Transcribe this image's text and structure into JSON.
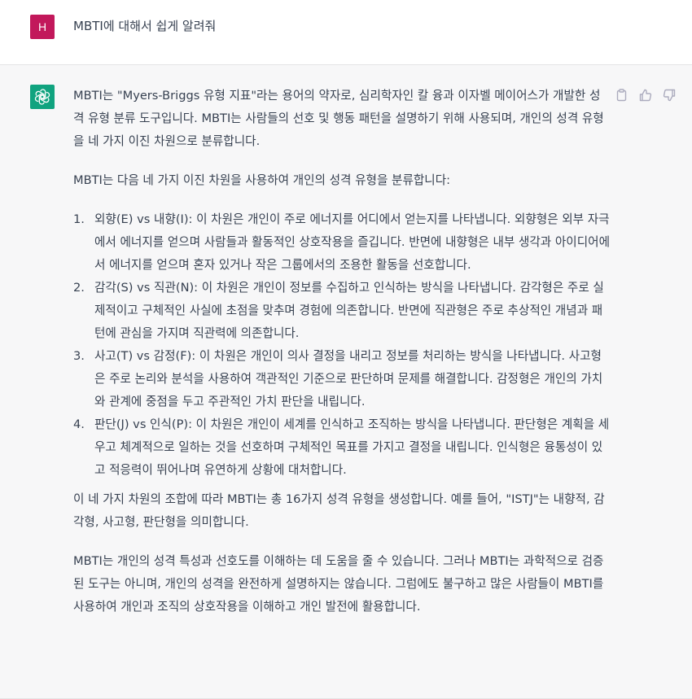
{
  "user_message": {
    "avatar_letter": "H",
    "avatar_color": "#c2185b",
    "text": "MBTI에 대해서 쉽게 알려줘"
  },
  "assistant_message": {
    "avatar_icon": "openai-logo-icon",
    "avatar_color": "#10a37f",
    "actions": [
      "copy-icon",
      "thumbs-up-icon",
      "thumbs-down-icon"
    ],
    "paragraph_1": "MBTI는 \"Myers-Briggs 유형 지표\"라는 용어의 약자로, 심리학자인 칼 융과 이자벨 메이어스가 개발한 성격 유형 분류 도구입니다. MBTI는 사람들의 선호 및 행동 패턴을 설명하기 위해 사용되며, 개인의 성격 유형을 네 가지 이진 차원으로 분류합니다.",
    "paragraph_2": "MBTI는 다음 네 가지 이진 차원을 사용하여 개인의 성격 유형을 분류합니다:",
    "list": [
      {
        "number": "1.",
        "text": "외향(E) vs 내향(I): 이 차원은 개인이 주로 에너지를 어디에서 얻는지를 나타냅니다. 외향형은 외부 자극에서 에너지를 얻으며 사람들과 활동적인 상호작용을 즐깁니다. 반면에 내향형은 내부 생각과 아이디어에서 에너지를 얻으며 혼자 있거나 작은 그룹에서의 조용한 활동을 선호합니다."
      },
      {
        "number": "2.",
        "text": "감각(S) vs 직관(N): 이 차원은 개인이 정보를 수집하고 인식하는 방식을 나타냅니다. 감각형은 주로 실제적이고 구체적인 사실에 초점을 맞추며 경험에 의존합니다. 반면에 직관형은 주로 추상적인 개념과 패턴에 관심을 가지며 직관력에 의존합니다."
      },
      {
        "number": "3.",
        "text": "사고(T) vs 감정(F): 이 차원은 개인이 의사 결정을 내리고 정보를 처리하는 방식을 나타냅니다. 사고형은 주로 논리와 분석을 사용하여 객관적인 기준으로 판단하며 문제를 해결합니다. 감정형은 개인의 가치와 관계에 중점을 두고 주관적인 가치 판단을 내립니다."
      },
      {
        "number": "4.",
        "text": "판단(J) vs 인식(P): 이 차원은 개인이 세계를 인식하고 조직하는 방식을 나타냅니다. 판단형은 계획을 세우고 체계적으로 일하는 것을 선호하며 구체적인 목표를 가지고 결정을 내립니다. 인식형은 융통성이 있고 적응력이 뛰어나며 유연하게 상황에 대처합니다."
      }
    ],
    "paragraph_3": "이 네 가지 차원의 조합에 따라 MBTI는 총 16가지 성격 유형을 생성합니다. 예를 들어, \"ISTJ\"는 내향적, 감각형, 사고형, 판단형을 의미합니다.",
    "paragraph_4": "MBTI는 개인의 성격 특성과 선호도를 이해하는 데 도움을 줄 수 있습니다. 그러나 MBTI는 과학적으로 검증된 도구는 아니며, 개인의 성격을 완전하게 설명하지는 않습니다. 그럼에도 불구하고 많은 사람들이 MBTI를 사용하여 개인과 조직의 상호작용을 이해하고 개인 발전에 활용합니다."
  }
}
